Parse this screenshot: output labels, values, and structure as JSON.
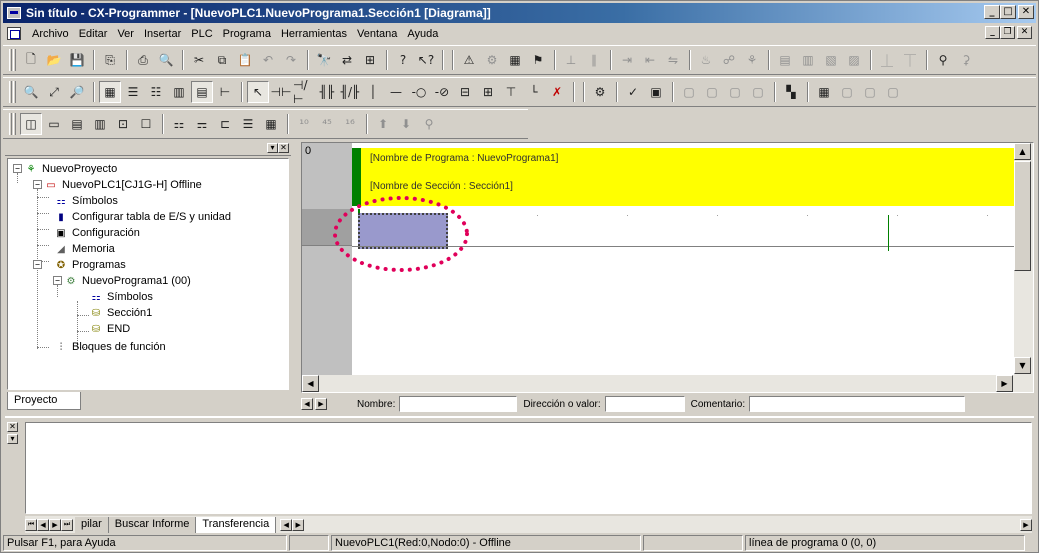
{
  "window": {
    "title": "Sin título - CX-Programmer - [NuevoPLC1.NuevoPrograma1.Sección1 [Diagrama]]"
  },
  "menu": {
    "items": [
      "Archivo",
      "Editar",
      "Ver",
      "Insertar",
      "PLC",
      "Programa",
      "Herramientas",
      "Ventana",
      "Ayuda"
    ]
  },
  "tree": {
    "root": "NuevoProyecto",
    "plc": "NuevoPLC1[CJ1G-H] Offline",
    "symbols": "Símbolos",
    "io_table": "Configurar tabla de E/S y unidad",
    "config": "Configuración",
    "memory": "Memoria",
    "programs": "Programas",
    "program1": "NuevoPrograma1 (00)",
    "prog_symbols": "Símbolos",
    "section1": "Sección1",
    "end": "END",
    "function_blocks": "Bloques de función"
  },
  "project_tab": "Proyecto",
  "diagram": {
    "rung_number": "0",
    "program_name": "[Nombre de Programa : NuevoPrograma1]",
    "section_name": "[Nombre de Sección : Sección1]",
    "header_color": "#ffff00",
    "cursor_color": "#9999cc",
    "highlight_color": "#e0005a"
  },
  "infobar": {
    "name_label": "Nombre:",
    "address_label": "Dirección o valor:",
    "comment_label": "Comentario:"
  },
  "output": {
    "tabs": [
      "pilar",
      "Buscar Informe",
      "Transferencia"
    ]
  },
  "status": {
    "help": "Pulsar F1, para Ayuda",
    "connection": "NuevoPLC1(Red:0,Nodo:0) - Offline",
    "line": "línea de programa 0 (0, 0)"
  }
}
